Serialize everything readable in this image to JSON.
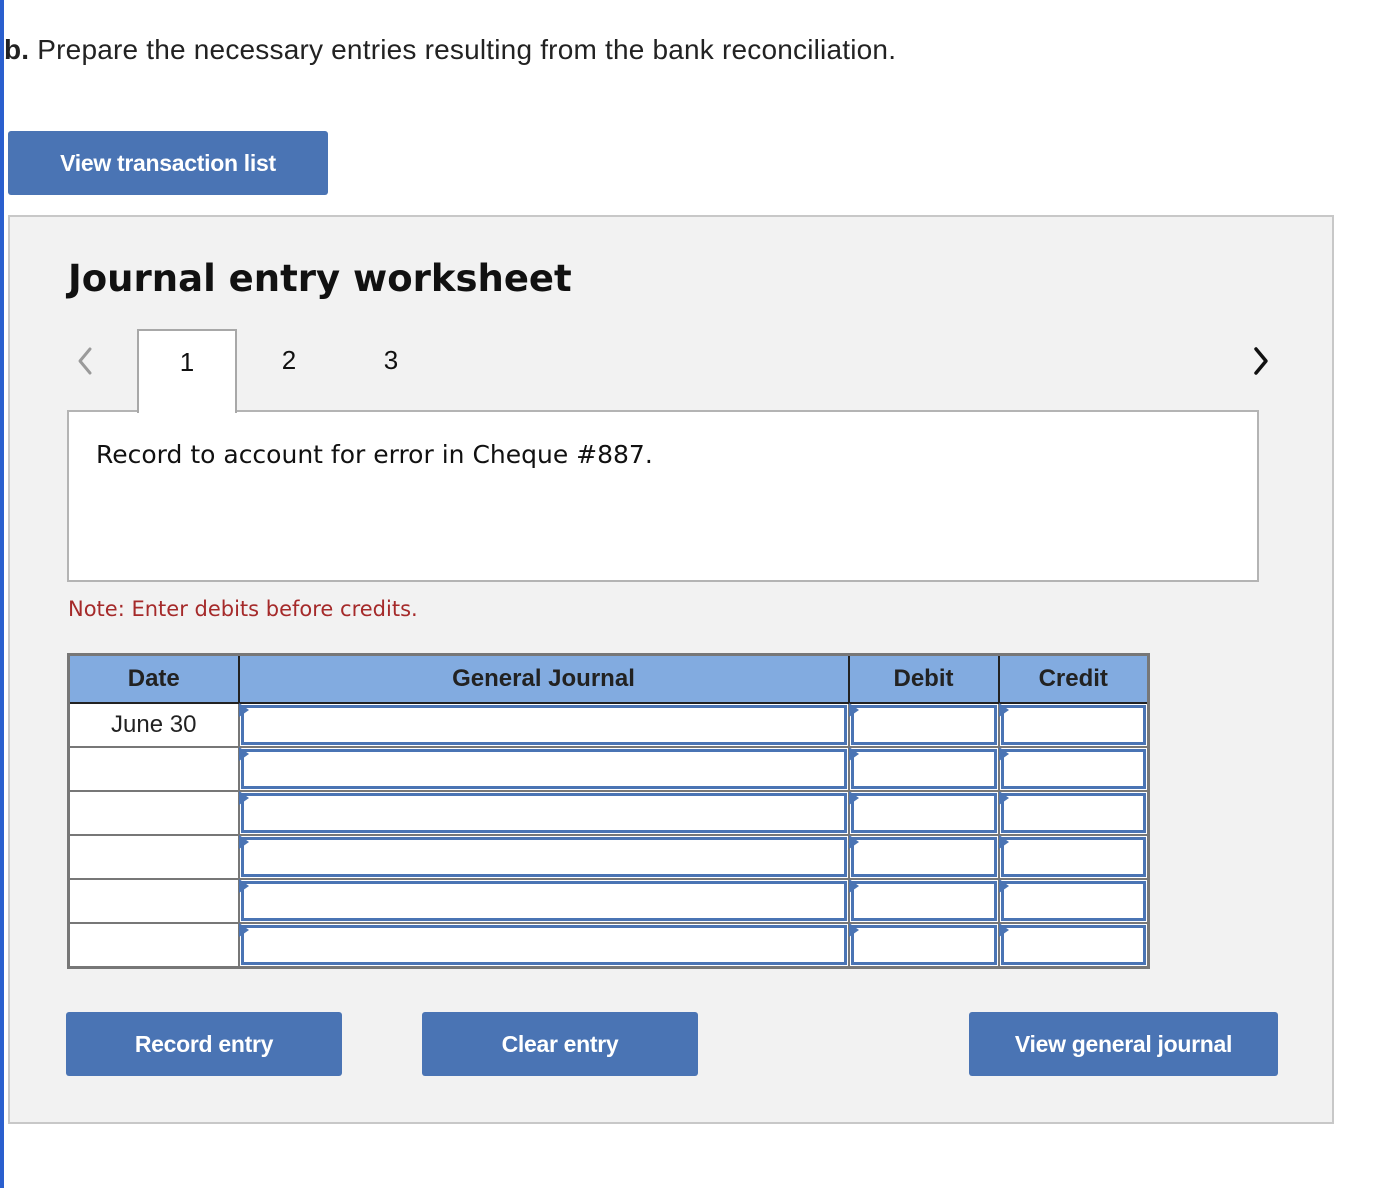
{
  "question": {
    "prefix": "b.",
    "text": " Prepare the necessary entries resulting from the bank reconciliation."
  },
  "buttons": {
    "view_transaction_list": "View transaction list",
    "record_entry": "Record entry",
    "clear_entry": "Clear entry",
    "view_general_journal": "View general journal"
  },
  "worksheet": {
    "title": "Journal entry worksheet",
    "tabs": [
      {
        "label": "1",
        "active": true
      },
      {
        "label": "2",
        "active": false
      },
      {
        "label": "3",
        "active": false
      }
    ],
    "description": "Record to account for error in Cheque #887.",
    "note": "Note: Enter debits before credits."
  },
  "journal": {
    "headers": {
      "date": "Date",
      "general_journal": "General Journal",
      "debit": "Debit",
      "credit": "Credit"
    },
    "rows": [
      {
        "date": "June 30",
        "account": "",
        "debit": "",
        "credit": ""
      },
      {
        "date": "",
        "account": "",
        "debit": "",
        "credit": ""
      },
      {
        "date": "",
        "account": "",
        "debit": "",
        "credit": ""
      },
      {
        "date": "",
        "account": "",
        "debit": "",
        "credit": ""
      },
      {
        "date": "",
        "account": "",
        "debit": "",
        "credit": ""
      },
      {
        "date": "",
        "account": "",
        "debit": "",
        "credit": ""
      }
    ]
  },
  "colors": {
    "accent": "#4a74b4",
    "header_bg": "#82abe0",
    "note": "#a52a2a",
    "panel_bg": "#f2f2f2"
  }
}
